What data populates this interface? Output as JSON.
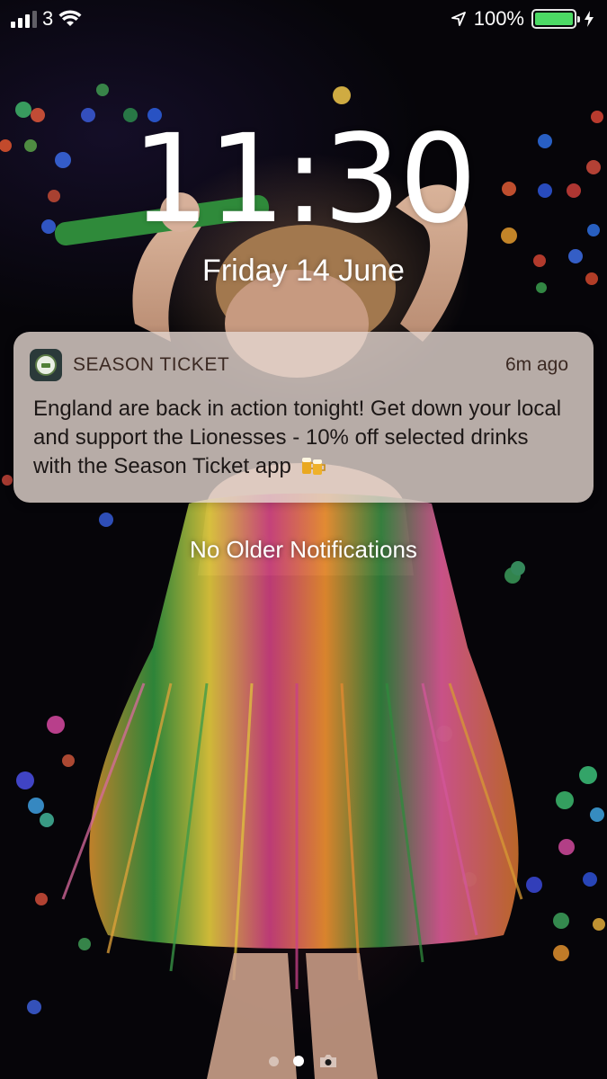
{
  "status_bar": {
    "carrier": "3",
    "battery": "100%",
    "signal_bars_full": 3,
    "signal_bars_total": 4
  },
  "lock_screen": {
    "time": "11:30",
    "date": "Friday 14 June",
    "no_older_text": "No Older Notifications"
  },
  "notification": {
    "app_name": "SEASON TICKET",
    "time_ago": "6m ago",
    "message": "England are back in action tonight! Get down your local and support the Lionesses - 10% off selected drinks with the Season Ticket app",
    "emoji": "beers-emoji"
  },
  "pager": {
    "pages": 2,
    "active_index": 1
  },
  "colors": {
    "battery_fill": "#4cd964",
    "notification_bg": "#e4d6d0"
  }
}
